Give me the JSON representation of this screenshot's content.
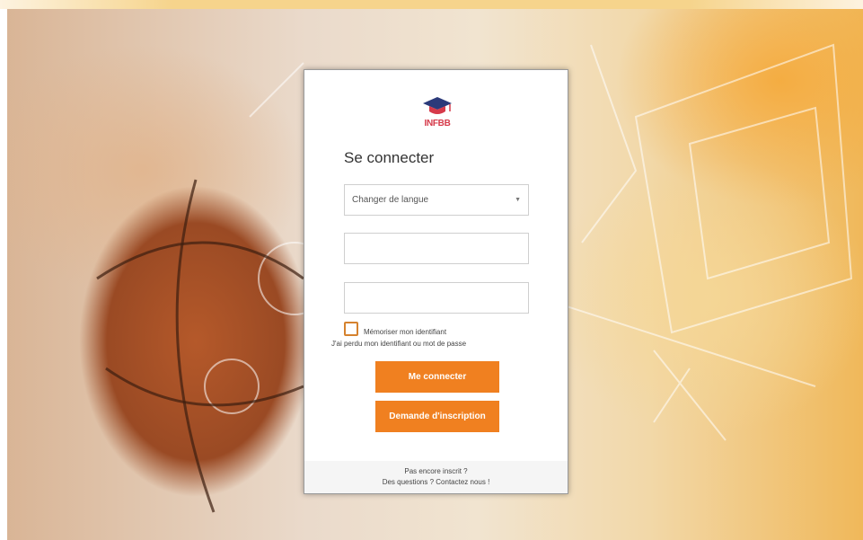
{
  "login": {
    "logo_text": "INFBB",
    "title": "Se connecter",
    "language_select": "Changer de langue",
    "identifier_value": "",
    "password_value": "",
    "remember_label": "Mémoriser mon identifiant",
    "lost_link": "J'ai perdu mon identifiant ou mot de passe",
    "login_button": "Me connecter",
    "signup_button": "Demande d'inscription",
    "footer_line1": "Pas encore inscrit ?",
    "footer_line2": "Des questions ? Contactez nous !"
  },
  "colors": {
    "accent": "#f08020",
    "logo": "#d63a4a",
    "checkbox_border": "#d5822e"
  },
  "icons": [
    "graduation-cap-icon",
    "chevron-down-icon"
  ]
}
